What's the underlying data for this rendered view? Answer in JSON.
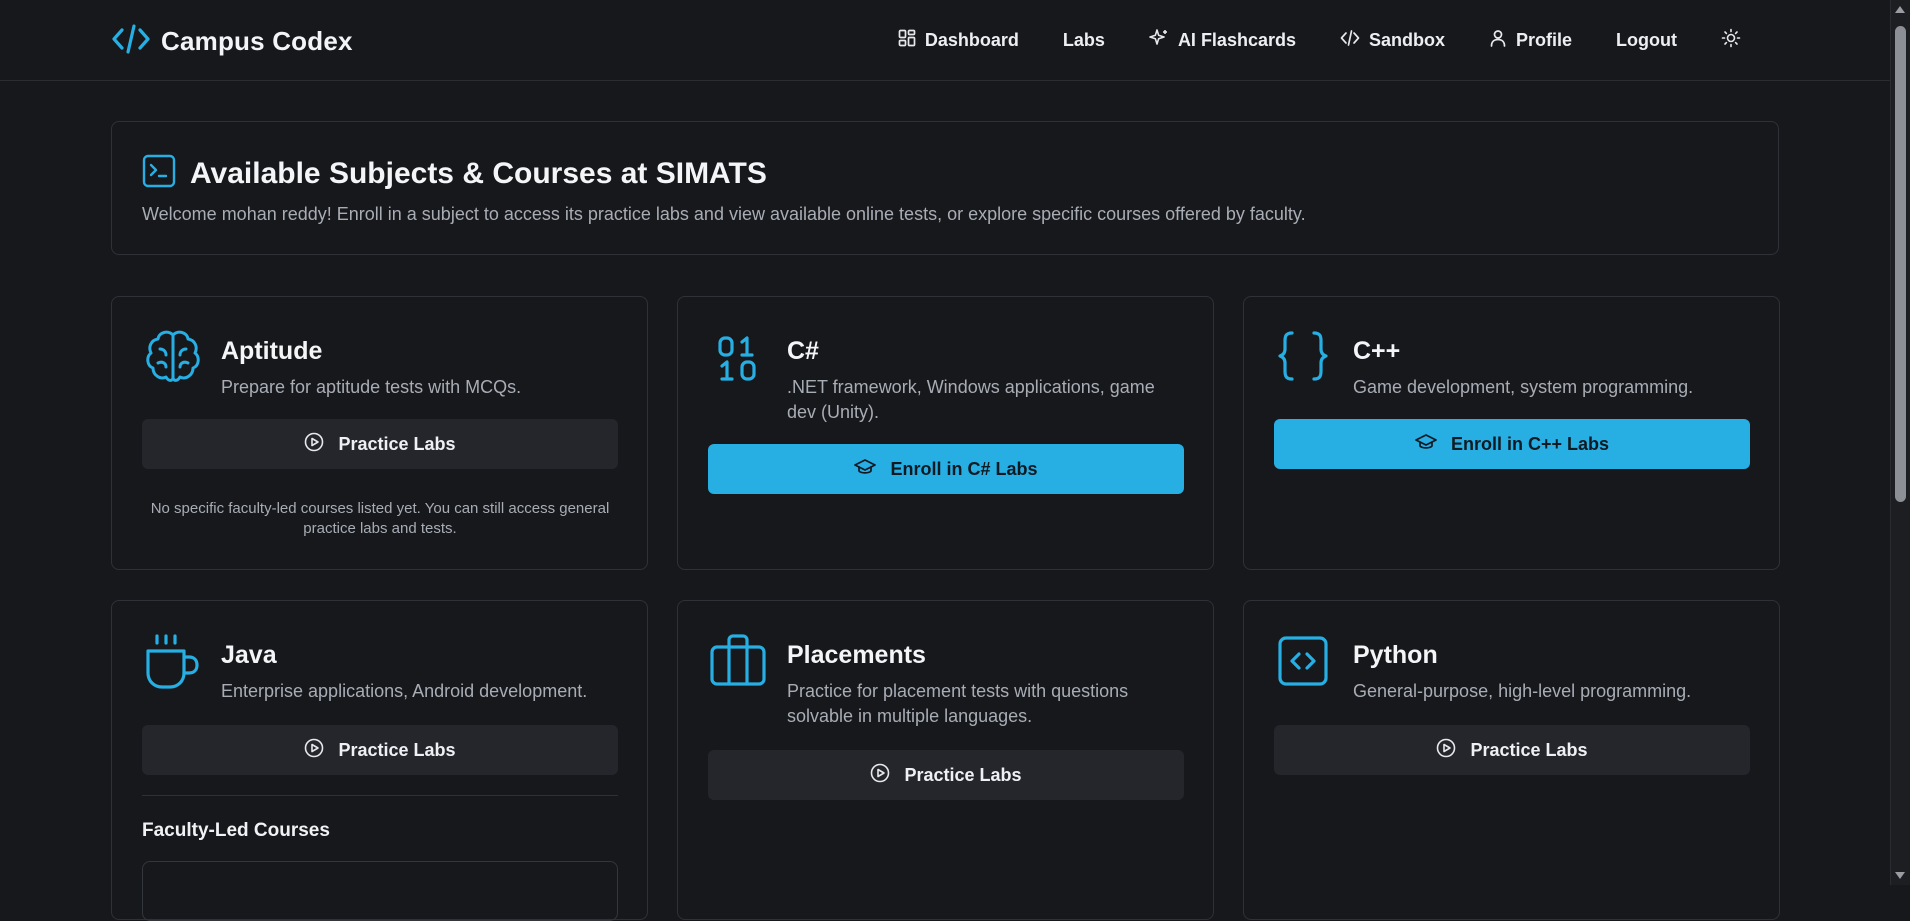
{
  "brand": {
    "title": "Campus Codex",
    "icon": "code-icon"
  },
  "nav": {
    "items": [
      {
        "label": "Dashboard",
        "icon": "dashboard-grid-icon"
      },
      {
        "label": "Labs"
      },
      {
        "label": "AI Flashcards",
        "icon": "sparkle-icon"
      },
      {
        "label": "Sandbox",
        "icon": "code-icon"
      },
      {
        "label": "Profile",
        "icon": "user-icon"
      },
      {
        "label": "Logout"
      }
    ],
    "theme_icon": "sun-icon"
  },
  "header": {
    "icon": "terminal-icon",
    "title": "Available Subjects & Courses at SIMATS",
    "subtitle": "Welcome mohan reddy! Enroll in a subject to access its practice labs and view available online tests, or explore specific courses offered by faculty."
  },
  "subjects": [
    {
      "title": "Aptitude",
      "description": "Prepare for aptitude tests with MCQs.",
      "icon": "brain-icon",
      "button": "Practice Labs",
      "button_icon": "play-circle-icon",
      "note": "No specific faculty-led courses listed yet. You can still access general practice labs and tests."
    },
    {
      "title": "C#",
      "description": ".NET framework, Windows applications, game dev (Unity).",
      "icon": "binary-icon",
      "button": "Enroll in C# Labs",
      "button_icon": "graduation-cap-icon"
    },
    {
      "title": "C++",
      "description": "Game development, system programming.",
      "icon": "braces-icon",
      "button": "Enroll in C++ Labs",
      "button_icon": "graduation-cap-icon"
    },
    {
      "title": "Java",
      "description": "Enterprise applications, Android development.",
      "icon": "coffee-icon",
      "button": "Practice Labs",
      "button_icon": "play-circle-icon",
      "section_title": "Faculty-Led Courses"
    },
    {
      "title": "Placements",
      "description": "Practice for placement tests with questions solvable in multiple languages.",
      "icon": "briefcase-icon",
      "button": "Practice Labs",
      "button_icon": "play-circle-icon"
    },
    {
      "title": "Python",
      "description": "General-purpose, high-level programming.",
      "icon": "code-square-icon",
      "button": "Practice Labs",
      "button_icon": "play-circle-icon"
    }
  ],
  "colors": {
    "accent": "#27aee3",
    "background": "#17181c",
    "card_border": "#2f3138",
    "secondary_button": "#24262c",
    "muted_text": "#a8acb5"
  }
}
